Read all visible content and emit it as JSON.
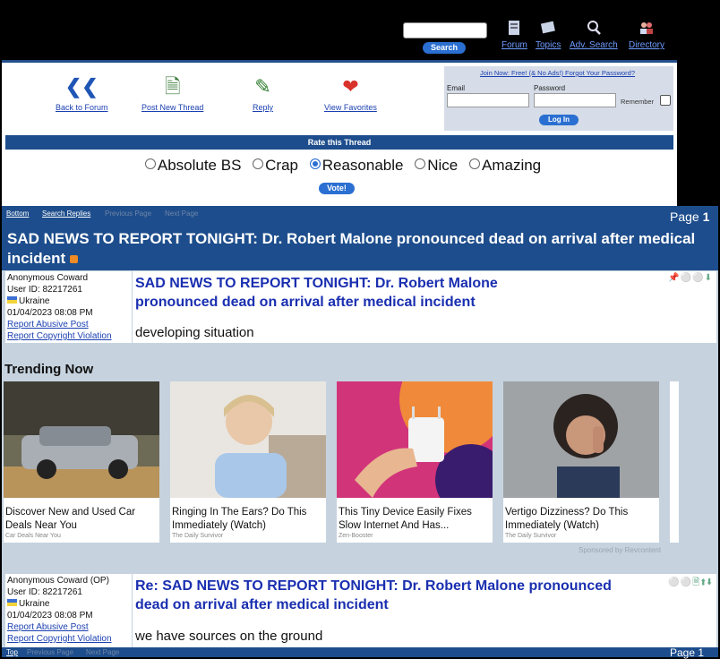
{
  "header": {
    "search_button": "Search",
    "nav": [
      {
        "label": "Forum",
        "icon": "forum-icon"
      },
      {
        "label": "Topics",
        "icon": "topics-icon"
      },
      {
        "label": "Adv. Search",
        "icon": "magnifier-icon"
      },
      {
        "label": "Directory",
        "icon": "people-icon"
      }
    ]
  },
  "tools": [
    {
      "label": "Back to Forum",
      "icon": "double-chevron-left-icon"
    },
    {
      "label": "Post New Thread",
      "icon": "new-document-icon"
    },
    {
      "label": "Reply",
      "icon": "reply-pencil-icon"
    },
    {
      "label": "View Favorites",
      "icon": "heart-icon"
    }
  ],
  "login": {
    "top_links": "Join Now: Free! (& No Ads!)  Forgot Your Password?",
    "email_label": "Email",
    "password_label": "Password",
    "remember_label": "Remember",
    "login_button": "Log In"
  },
  "rating": {
    "bar_title": "Rate this Thread",
    "options": [
      "Absolute BS",
      "Crap",
      "Reasonable",
      "Nice",
      "Amazing"
    ],
    "selected": "Reasonable",
    "vote_button": "Vote!"
  },
  "thread_nav": {
    "links": [
      "Bottom",
      "Search Replies",
      "Previous Page",
      "Next Page"
    ],
    "page_prefix": "Page",
    "page_number": "1"
  },
  "thread": {
    "title": "SAD NEWS TO REPORT TONIGHT: Dr. Robert Malone pronounced dead on arrival after medical incident",
    "posts": [
      {
        "author": "Anonymous Coward",
        "user_id": "User ID: 82217261",
        "country": "Ukraine",
        "datetime": "01/04/2023 08:08 PM",
        "report_abuse": "Report Abusive Post",
        "report_copyright": "Report Copyright Violation",
        "title": "SAD NEWS TO REPORT TONIGHT: Dr. Robert Malone pronounced dead on arrival after medical incident",
        "body": "developing situation"
      },
      {
        "author": "Anonymous Coward (OP)",
        "user_id": "User ID: 82217261",
        "country": "Ukraine",
        "datetime": "01/04/2023 08:08 PM",
        "report_abuse": "Report Abusive Post",
        "report_copyright": "Report Copyright Violation",
        "title": "Re: SAD NEWS TO REPORT TONIGHT: Dr. Robert Malone pronounced dead on arrival after medical incident",
        "body": "we have sources on the ground"
      }
    ]
  },
  "trending": {
    "label": "Trending Now",
    "cards": [
      {
        "caption": "Discover New and Used Car Deals Near You",
        "source": "Car Deals Near You"
      },
      {
        "caption": "Ringing In The Ears? Do This Immediately (Watch)",
        "source": "The Daily Survivor"
      },
      {
        "caption": "This Tiny Device Easily Fixes Slow Internet And Has...",
        "source": "Zen-Booster"
      },
      {
        "caption": "Vertigo Dizziness? Do This Immediately (Watch)",
        "source": "The Daily Survivor"
      }
    ],
    "sponsored": "Sponsored by Revcontent"
  },
  "bottom_nav": {
    "links": [
      "Top",
      "Previous Page",
      "Next Page"
    ],
    "page_label": "Page 1"
  }
}
